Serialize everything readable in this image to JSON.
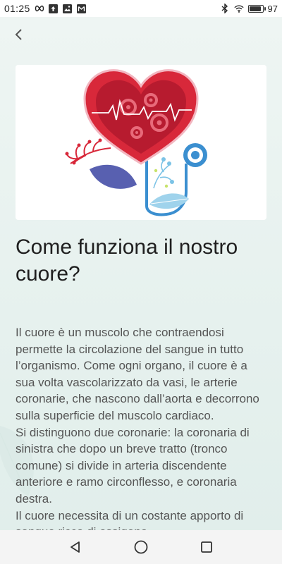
{
  "status_bar": {
    "time": "01:25",
    "battery_level": "97",
    "battery_fraction": 0.97,
    "icons": [
      "infinity-icon",
      "upload-icon",
      "image-icon",
      "gmail-icon",
      "bluetooth-icon",
      "wifi-icon",
      "battery-icon"
    ]
  },
  "article": {
    "title": "Come funziona il nostro cuore?",
    "paragraphs": [
      "Il cuore è un muscolo che contraendosi permette la circolazione del sangue in tutto l’organismo. Come ogni organo, il cuore è a sua volta vascolarizzato da vasi, le arterie coronarie, che nascono dall’aorta e decorrono sulla superficie del muscolo cardiaco.",
      "Si distinguono due coronarie: la coronaria di sinistra che dopo un breve tratto (tronco comune) si divide in arteria discendente anteriore e ramo circonflesso, e coronaria destra.",
      "Il cuore necessita di un costante apporto di sangue ricco di ossigeno"
    ]
  },
  "colors": {
    "background": "#eaf3f1",
    "heart_red": "#d8283a",
    "stethoscope_blue": "#3b8fd0",
    "title_text": "#1f1f1f",
    "body_text": "#555555"
  },
  "navigation": {
    "back": "back-icon",
    "buttons": [
      "nav-back-icon",
      "nav-home-icon",
      "nav-recents-icon"
    ]
  }
}
